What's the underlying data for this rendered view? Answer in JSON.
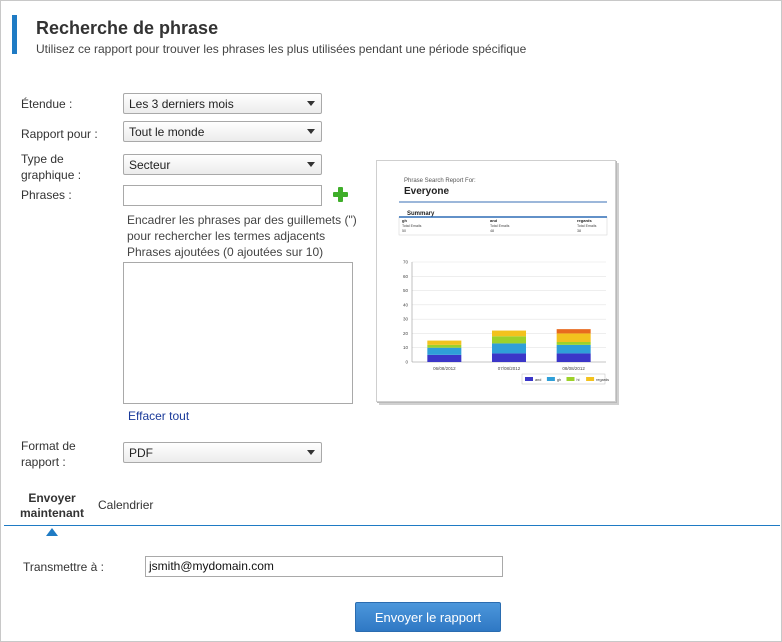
{
  "header": {
    "title": "Recherche de phrase",
    "subtitle": "Utilisez ce rapport pour trouver les phrases les plus utilisées pendant une période spécifique"
  },
  "form": {
    "etendue": {
      "label": "Étendue :",
      "value": "Les 3 derniers mois"
    },
    "rapport_pour": {
      "label": "Rapport pour :",
      "value": "Tout le monde"
    },
    "type_graphique": {
      "label_line1": "Type de",
      "label_line2": "graphique :",
      "value": "Secteur"
    },
    "phrases": {
      "label": "Phrases :",
      "value": ""
    },
    "hint_line1": "Encadrer les phrases par des guillemets (\")",
    "hint_line2": "pour rechercher les termes adjacents",
    "added_phrases": "Phrases ajoutées (0 ajoutées sur 10)",
    "clear_all": "Effacer tout",
    "format": {
      "label_line1": "Format de",
      "label_line2": "rapport :",
      "value": "PDF"
    }
  },
  "preview": {
    "heading": "Phrase Search Report For:",
    "user": "Everyone",
    "summary_title": "Summary",
    "summary_cols": [
      {
        "term": "gh",
        "metric": "Total Emails",
        "value": "50"
      },
      {
        "term": "and",
        "metric": "Total Emails",
        "value": "48"
      },
      {
        "term": "regards",
        "metric": "Total Emails",
        "value": "38"
      }
    ],
    "chart_data": {
      "type": "bar",
      "stacked": true,
      "categories": [
        "06/08/2012",
        "07/08/2012",
        "08/08/2012"
      ],
      "series": [
        {
          "name": "and",
          "color": "#3b36c8",
          "values": [
            5,
            6,
            6
          ]
        },
        {
          "name": "gh",
          "color": "#2f9fd8",
          "values": [
            5,
            7,
            6
          ]
        },
        {
          "name": "hi",
          "color": "#9dd12a",
          "values": [
            2,
            5,
            2
          ]
        },
        {
          "name": "regards",
          "color": "#f2c21e",
          "values": [
            3,
            4,
            6
          ]
        },
        {
          "name": "",
          "color": "#e86a1e",
          "values": [
            0,
            0,
            3
          ]
        }
      ],
      "yticks": [
        "0",
        "10",
        "20",
        "30",
        "40",
        "50",
        "60",
        "70"
      ],
      "ylim": [
        0,
        70
      ],
      "grid": true,
      "legend": "bottom-right"
    }
  },
  "tabs": {
    "send_now_line1": "Envoyer",
    "send_now_line2": "maintenant",
    "schedule": "Calendrier"
  },
  "send": {
    "label": "Transmettre à :",
    "value": "jsmith@mydomain.com",
    "button": "Envoyer le rapport"
  },
  "colors": {
    "accent": "#1f7bc4",
    "button": "#2f78c4",
    "link": "#1a3a9a"
  }
}
